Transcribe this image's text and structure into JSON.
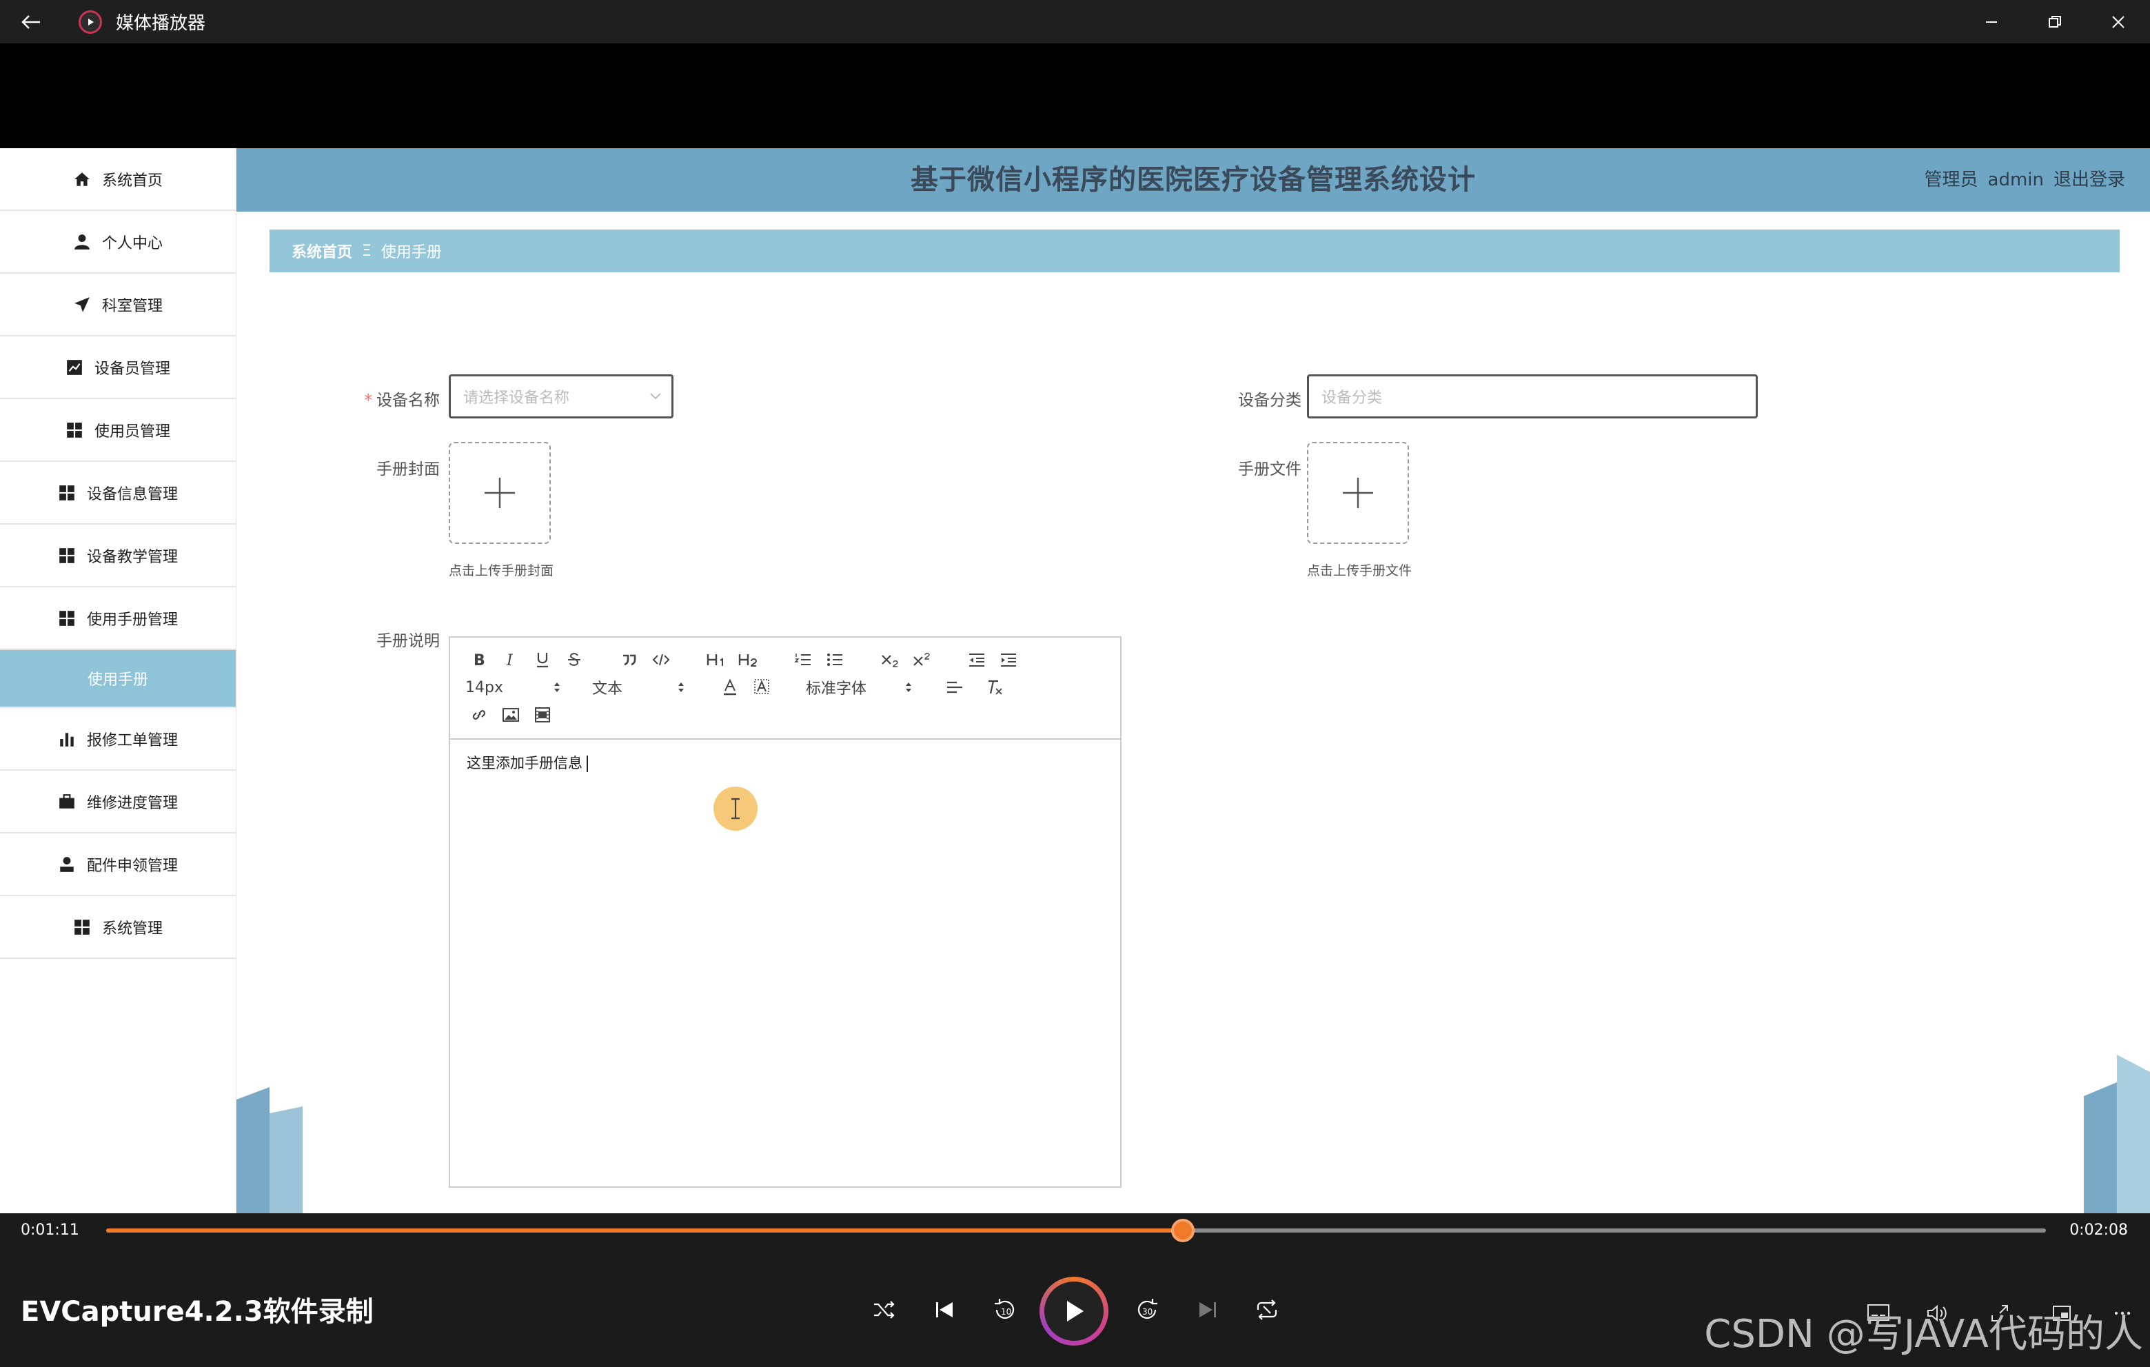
{
  "window": {
    "title": "媒体播放器"
  },
  "header": {
    "title": "基于微信小程序的医院医疗设备管理系统设计",
    "role": "管理员",
    "user": "admin",
    "logout": "退出登录"
  },
  "sidebar": {
    "items": [
      {
        "label": "系统首页",
        "icon": "home-icon"
      },
      {
        "label": "个人中心",
        "icon": "person-icon"
      },
      {
        "label": "科室管理",
        "icon": "paper-plane-icon"
      },
      {
        "label": "设备员管理",
        "icon": "chart-icon"
      },
      {
        "label": "使用员管理",
        "icon": "grid-icon"
      },
      {
        "label": "设备信息管理",
        "icon": "grid-icon"
      },
      {
        "label": "设备教学管理",
        "icon": "grid-icon"
      },
      {
        "label": "使用手册管理",
        "icon": "grid-icon"
      }
    ],
    "active_sub": "使用手册",
    "items2": [
      {
        "label": "报修工单管理",
        "icon": "bar-chart-icon"
      },
      {
        "label": "维修进度管理",
        "icon": "briefcase-icon"
      },
      {
        "label": "配件申领管理",
        "icon": "user-icon"
      },
      {
        "label": "系统管理",
        "icon": "grid-icon"
      }
    ]
  },
  "breadcrumb": {
    "home": "系统首页",
    "sep": "Ξ",
    "current": "使用手册"
  },
  "form": {
    "device_name_label": "设备名称",
    "device_name_placeholder": "请选择设备名称",
    "device_category_label": "设备分类",
    "device_category_placeholder": "设备分类",
    "cover_label": "手册封面",
    "cover_hint": "点击上传手册封面",
    "file_label": "手册文件",
    "file_hint": "点击上传手册文件",
    "desc_label": "手册说明"
  },
  "editor": {
    "font_size": "14px",
    "block_type": "文本",
    "font_family": "标准字体",
    "content": "这里添加手册信息"
  },
  "player": {
    "current_time": "0:01:11",
    "total_time": "0:02:08",
    "progress": 0.555,
    "recorder_label": "EVCapture4.2.3软件录制",
    "watermark": "CSDN @写JAVA代码的人"
  },
  "colors": {
    "accent": "#f07a2a",
    "header": "#6fa6c4",
    "crumb": "#94c6d9",
    "active": "#8fc3d8"
  }
}
